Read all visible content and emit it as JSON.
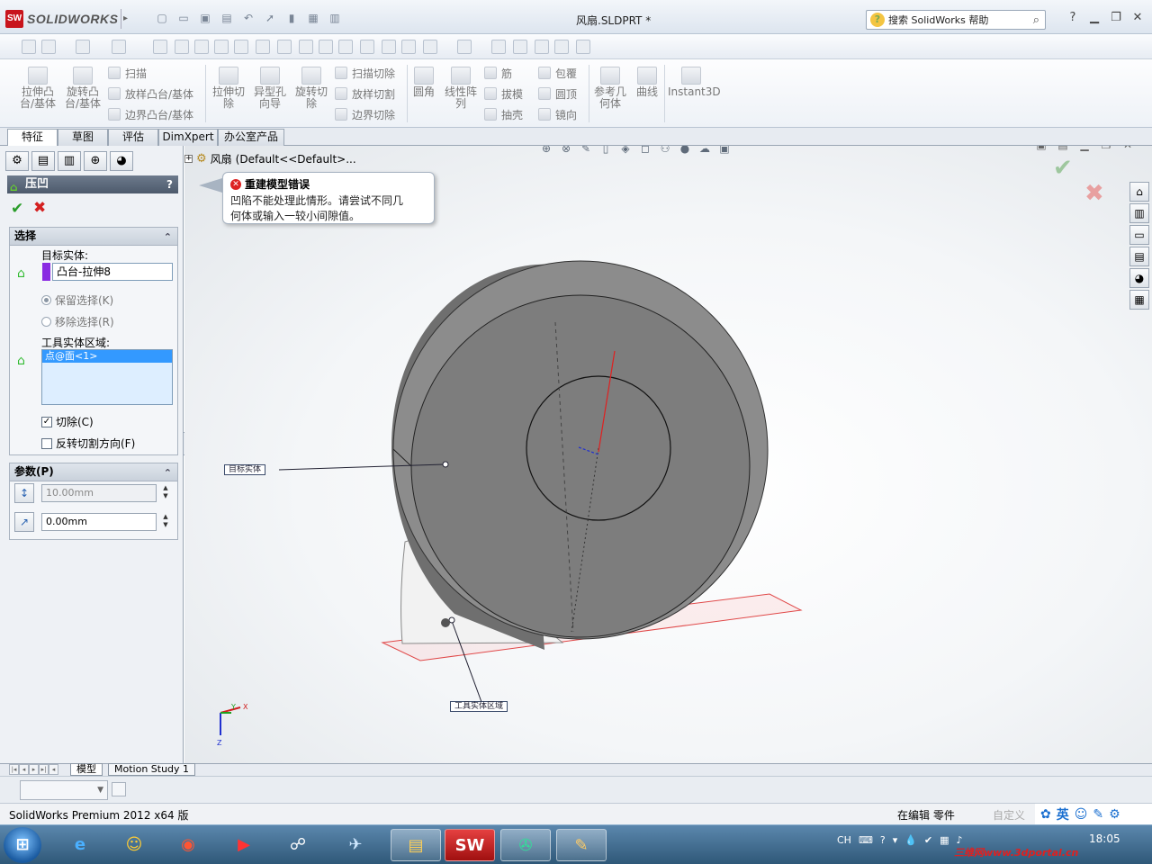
{
  "app": {
    "logo_text": "SOLIDWORKS",
    "doc_title": "风扇.SLDPRT *",
    "help_search_placeholder": "搜索 SolidWorks 帮助"
  },
  "command_manager": {
    "extrude_boss": "拉伸凸台/基体",
    "revolve_boss": "旋转凸台/基体",
    "sweep": "扫描",
    "loft_boss": "放样凸台/基体",
    "boundary_boss": "边界凸台/基体",
    "extruded_cut": "拉伸切除",
    "hole_wizard": "异型孔向导",
    "revolved_cut": "旋转切除",
    "swept_cut": "扫描切除",
    "lofted_cut": "放样切割",
    "boundary_cut": "边界切除",
    "fillet": "圆角",
    "linear_pattern": "线性阵列",
    "rib": "筋",
    "draft": "拔模",
    "shell": "抽壳",
    "wrap": "包覆",
    "dome": "圆顶",
    "mirror": "镜向",
    "ref_geometry": "参考几何体",
    "curves": "曲线",
    "instant3d": "Instant3D"
  },
  "tabs": [
    "特征",
    "草图",
    "评估",
    "DimXpert",
    "办公室产品"
  ],
  "property_manager": {
    "title": "压凹",
    "help": "?",
    "selection": {
      "title": "选择",
      "target_label": "目标实体:",
      "target_value": "凸台-拉伸8",
      "keep_selection": "保留选择(K)",
      "remove_selection": "移除选择(R)",
      "tool_region_label": "工具实体区域:",
      "tool_region_item": "点@面<1>",
      "cut": "切除(C)",
      "reverse_cut": "反转切割方向(F)"
    },
    "parameters": {
      "title": "参数(P)",
      "thickness": "10.00mm",
      "clearance": "0.00mm"
    }
  },
  "graphics": {
    "tree_root": "风扇",
    "tree_config": "(Default<<Default>...",
    "error_title": "重建模型错误",
    "error_line1": "凹陷不能处理此情形。请尝试不同几",
    "error_line2": "何体或输入一较小间隙值。",
    "callout_target": "目标实体",
    "callout_tool": "工具实体区域",
    "axis_x": "X",
    "axis_y": "Y",
    "axis_z": "Z"
  },
  "bottom_tabs": [
    "模型",
    "Motion Study 1"
  ],
  "status": {
    "product": "SolidWorks Premium 2012 x64 版",
    "mode": "在编辑 零件",
    "custom": "自定义",
    "ime_lang": "英"
  },
  "taskbar": {
    "sw_label": "SW",
    "tray_lang": "CH",
    "clock": "18:05",
    "watermark": "三维网www.3dportal.cn"
  },
  "colors": {
    "sw_red": "#c8141c",
    "ok_green": "#2a9d2a",
    "cancel_red": "#d42020",
    "accent_blue": "#3399ff"
  }
}
